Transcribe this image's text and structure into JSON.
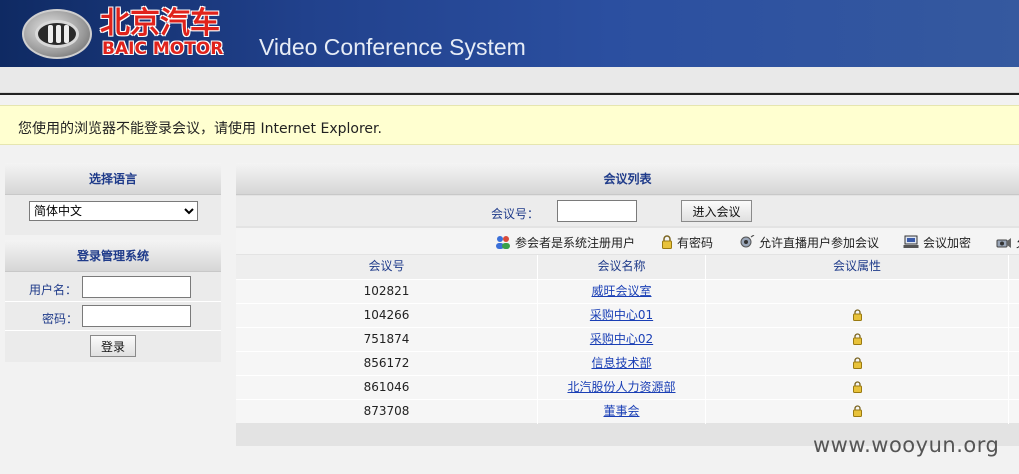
{
  "header": {
    "logo_cn": "北京汽车",
    "logo_en": "BAIC MOTOR",
    "title": "Video Conference System"
  },
  "notice": "您使用的浏览器不能登录会议，请使用 Internet Explorer.",
  "language": {
    "title": "选择语言",
    "selected": "简体中文"
  },
  "login": {
    "title": "登录管理系统",
    "username_label": "用户名：",
    "password_label": "密码：",
    "button": "登录"
  },
  "conference": {
    "title": "会议列表",
    "number_label": "会议号：",
    "join_button": "进入会议",
    "legend": [
      {
        "icon": "registered-users-icon",
        "label": "参会者是系统注册用户"
      },
      {
        "icon": "lock-icon",
        "label": "有密码"
      },
      {
        "icon": "broadcast-icon",
        "label": "允许直播用户参加会议"
      },
      {
        "icon": "computer-icon",
        "label": "会议加密"
      },
      {
        "icon": "camera-icon",
        "label": "允"
      }
    ],
    "columns": [
      "会议号",
      "会议名称",
      "会议属性"
    ],
    "rows": [
      {
        "id": "102821",
        "name": "威旺会议室",
        "locked": false
      },
      {
        "id": "104266",
        "name": "采购中心01",
        "locked": true
      },
      {
        "id": "751874",
        "name": "采购中心02",
        "locked": true
      },
      {
        "id": "856172",
        "name": "信息技术部",
        "locked": true
      },
      {
        "id": "861046",
        "name": "北汽股份人力资源部",
        "locked": true
      },
      {
        "id": "873708",
        "name": "董事会",
        "locked": true
      }
    ]
  },
  "watermark": "www.wooyun.org",
  "colors": {
    "header_dark": "#0f2a63",
    "brand_red": "#e0231c",
    "panel_title": "#1f3b8a",
    "link": "#1a3fb5",
    "notice_bg": "#ffffd0"
  }
}
